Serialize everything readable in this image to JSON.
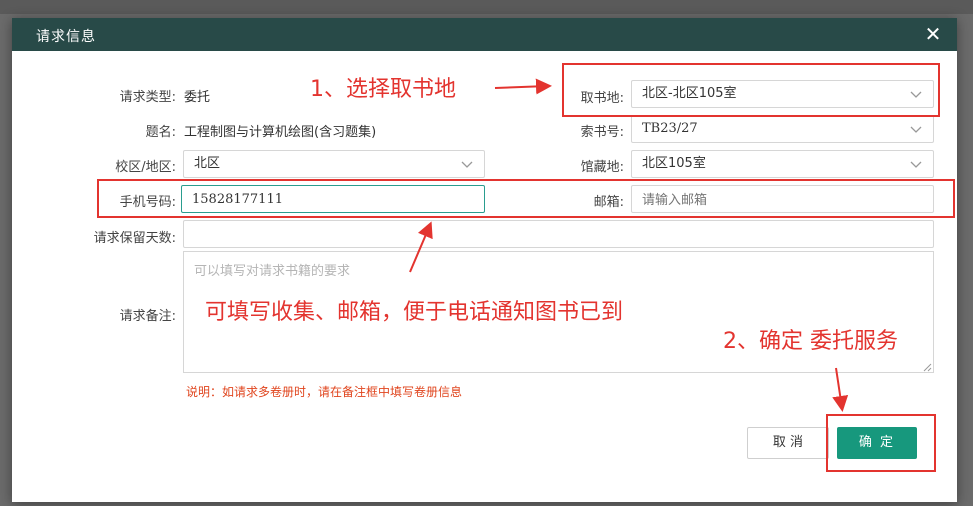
{
  "dialog": {
    "title": "请求信息",
    "close_label": "✕"
  },
  "form": {
    "request_type": {
      "label": "请求类型:",
      "value": "委托"
    },
    "title": {
      "label": "题名:",
      "value": "工程制图与计算机绘图(含习题集)"
    },
    "campus": {
      "label": "校区/地区:",
      "value": "北区"
    },
    "phone": {
      "label": "手机号码:",
      "value": "15828177111"
    },
    "hold_days": {
      "label": "请求保留天数:",
      "value": ""
    },
    "remark": {
      "label": "请求备注:",
      "placeholder": "可以填写对请求书籍的要求"
    },
    "pickup": {
      "label": "取书地:",
      "value": "北区-北区105室"
    },
    "call_no": {
      "label": "索书号:",
      "value": "TB23/27"
    },
    "location": {
      "label": "馆藏地:",
      "value": "北区105室"
    },
    "email": {
      "label": "邮箱:",
      "placeholder": "请输入邮箱"
    },
    "note": "说明：如请求多卷册时，请在备注框中填写卷册信息"
  },
  "buttons": {
    "cancel": "取 消",
    "ok": "确 定"
  },
  "annotations": {
    "step1": "1、选择取书地",
    "phone_hint": "可填写收集、邮箱，便于电话通知图书已到",
    "step2": "2、确定 委托服务",
    "color": "#e3342f"
  },
  "colors": {
    "header": "#284a48",
    "confirm": "#17987d",
    "note": "#e0451e"
  }
}
